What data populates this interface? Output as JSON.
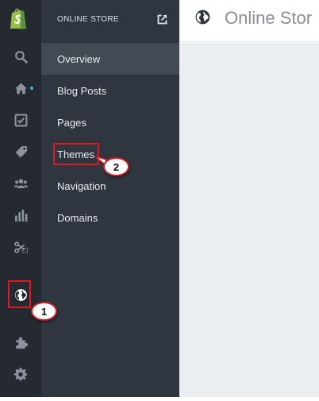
{
  "app": {
    "brand_color": "#95bf47"
  },
  "rail": {
    "items": [
      {
        "icon": "search-icon"
      },
      {
        "icon": "home-icon",
        "has_notification": true
      },
      {
        "icon": "orders-checkbox-icon"
      },
      {
        "icon": "tag-icon"
      },
      {
        "icon": "customers-icon"
      },
      {
        "icon": "reports-bar-chart-icon"
      },
      {
        "icon": "discounts-scissors-icon"
      },
      {
        "icon": "globe-icon",
        "active": true
      },
      {
        "icon": "puzzle-icon"
      },
      {
        "icon": "gear-icon"
      }
    ]
  },
  "sidebar": {
    "title": "ONLINE STORE",
    "items": [
      {
        "label": "Overview",
        "active": true
      },
      {
        "label": "Blog Posts"
      },
      {
        "label": "Pages"
      },
      {
        "label": "Themes"
      },
      {
        "label": "Navigation"
      },
      {
        "label": "Domains"
      }
    ]
  },
  "header": {
    "title": "Online Stor"
  },
  "annotations": [
    {
      "label": "1"
    },
    {
      "label": "2"
    }
  ],
  "colors": {
    "rail": "#252a31",
    "sidebar": "#30363f",
    "active_item": "#424a54",
    "annotation": "#e0191f"
  }
}
